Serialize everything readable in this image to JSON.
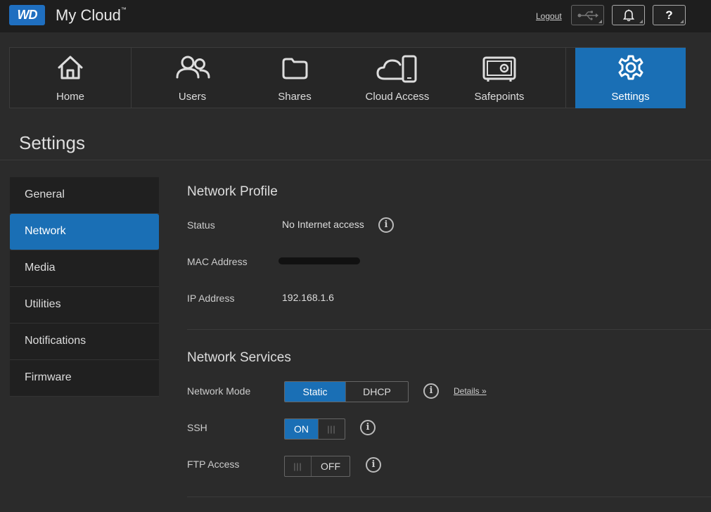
{
  "header": {
    "logo_text": "WD",
    "app_title": "My Cloud",
    "trademark": "™",
    "logout": "Logout",
    "help_label": "?"
  },
  "nav": {
    "items": [
      {
        "label": "Home",
        "icon": "home-icon"
      },
      {
        "label": "Users",
        "icon": "users-icon"
      },
      {
        "label": "Shares",
        "icon": "folder-icon"
      },
      {
        "label": "Cloud Access",
        "icon": "cloud-device-icon"
      },
      {
        "label": "Safepoints",
        "icon": "safe-icon"
      },
      {
        "label": "Settings",
        "icon": "gear-icon",
        "active": true
      }
    ]
  },
  "page": {
    "title": "Settings"
  },
  "sidebar": {
    "items": [
      {
        "label": "General"
      },
      {
        "label": "Network",
        "active": true
      },
      {
        "label": "Media"
      },
      {
        "label": "Utilities"
      },
      {
        "label": "Notifications"
      },
      {
        "label": "Firmware"
      }
    ]
  },
  "network_profile": {
    "title": "Network Profile",
    "status_label": "Status",
    "status_value": "No Internet access",
    "mac_label": "MAC Address",
    "ip_label": "IP Address",
    "ip_value": "192.168.1.6"
  },
  "network_services": {
    "title": "Network Services",
    "mode_label": "Network Mode",
    "mode_static": "Static",
    "mode_dhcp": "DHCP",
    "details_link": "Details »",
    "ssh_label": "SSH",
    "ssh_state": "ON",
    "ftp_label": "FTP Access",
    "ftp_state": "OFF",
    "grip": "|||"
  },
  "colors": {
    "accent": "#1a6fb5",
    "background": "#2b2b2b",
    "topbar": "#1e1e1e"
  }
}
